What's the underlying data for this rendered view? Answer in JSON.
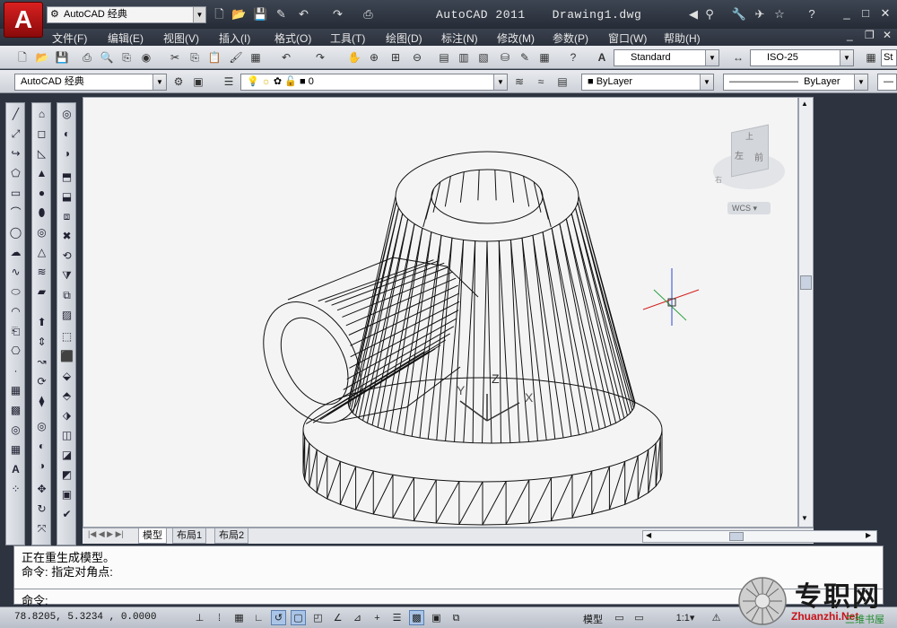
{
  "app": {
    "title": "AutoCAD 2011",
    "document": "Drawing1.dwg",
    "logo_letter": "A",
    "workspace": "AutoCAD 经典"
  },
  "menu": [
    "文件(F)",
    "编辑(E)",
    "视图(V)",
    "插入(I)",
    "格式(O)",
    "工具(T)",
    "绘图(D)",
    "标注(N)",
    "修改(M)",
    "参数(P)",
    "窗口(W)",
    "帮助(H)"
  ],
  "toolbar": {
    "text_style": "Standard",
    "dim_style": "ISO-25",
    "table_style_partial": "St",
    "workspace2": "AutoCAD 经典",
    "layer": "0",
    "color": "ByLayer",
    "linetype": "ByLayer"
  },
  "viewport": {
    "viewcube_top": "上",
    "viewcube_left": "左",
    "viewcube_front": "前",
    "viewcube_right": "右",
    "wcs": "WCS",
    "ucs_z": "Z",
    "ucs_y": "Y",
    "ucs_x": "X"
  },
  "tabs": [
    "模型",
    "布局1",
    "布局2"
  ],
  "command": {
    "line1": "正在重生成模型。",
    "line2": "命令: 指定对角点:",
    "prompt": "命令:"
  },
  "status": {
    "coords": "78.8205,  5.3234 , 0.0000",
    "model": "模型",
    "scale": "1:1"
  },
  "watermark": {
    "title": "专职网",
    "url": "Zhuanzhi.Net",
    "sub": "三维书屋"
  },
  "colors": {
    "accent_red": "#c8141a",
    "title_bg": "#2d3440",
    "canvas": "#f4f4f4"
  }
}
